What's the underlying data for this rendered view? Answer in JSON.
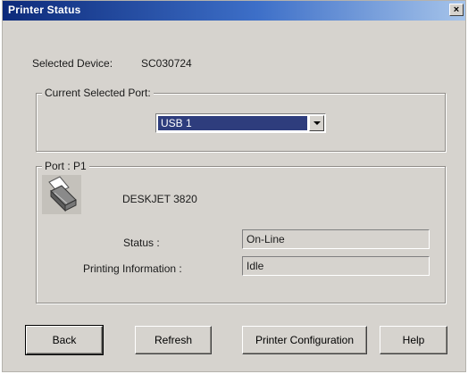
{
  "window": {
    "title": "Printer Status",
    "close_symbol": "×"
  },
  "selected_device": {
    "label": "Selected Device:",
    "value": "SC030724"
  },
  "current_port_group": {
    "legend": "Current Selected Port:",
    "combo": {
      "selected": "USB 1"
    }
  },
  "port_group": {
    "legend": "Port : P1",
    "icon": "printer-icon",
    "printer_name": "DESKJET 3820",
    "status_label": "Status :",
    "status_value": "On-Line",
    "printing_info_label": "Printing Information :",
    "printing_info_value": "Idle"
  },
  "buttons": {
    "back": "Back",
    "refresh": "Refresh",
    "printer_configuration": "Printer Configuration",
    "help": "Help"
  }
}
